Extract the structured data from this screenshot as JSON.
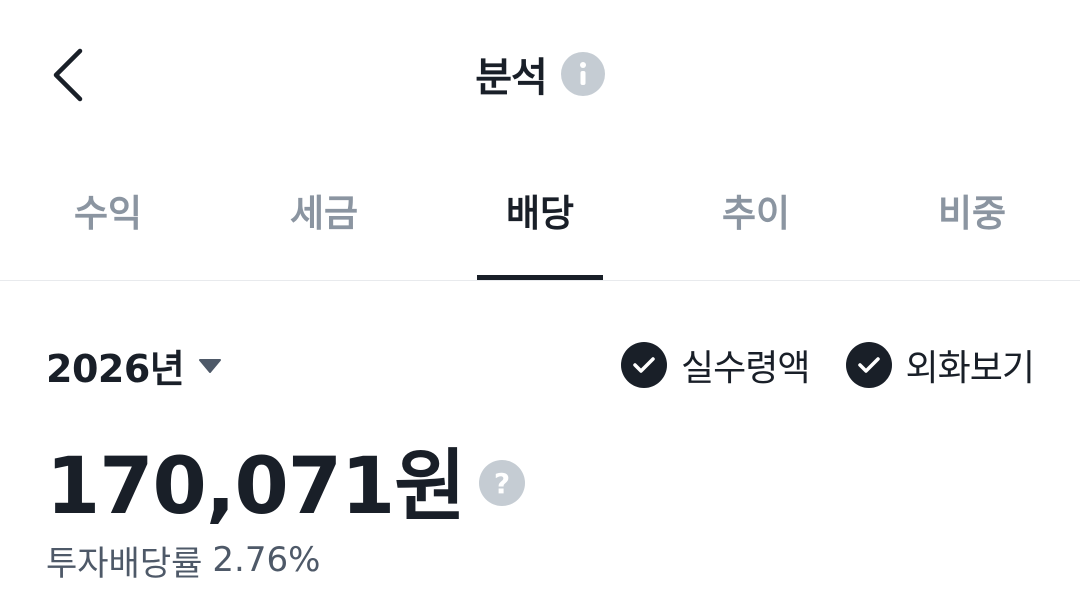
{
  "header": {
    "title": "분석",
    "back_icon": "chevron-left-icon",
    "info_icon": "info-icon"
  },
  "tabs": [
    {
      "label": "수익",
      "active": false
    },
    {
      "label": "세금",
      "active": false
    },
    {
      "label": "배당",
      "active": true
    },
    {
      "label": "추이",
      "active": false
    },
    {
      "label": "비중",
      "active": false
    }
  ],
  "filters": {
    "year": "2026년",
    "net_amount_label": "실수령액",
    "net_amount_checked": true,
    "foreign_currency_label": "외화보기",
    "foreign_currency_checked": true
  },
  "summary": {
    "amount": "170,071원",
    "help_icon": "?",
    "yield_label": "투자배당률",
    "yield_value": "2.76%"
  },
  "colors": {
    "text_primary": "#191f28",
    "text_secondary": "#8b95a1",
    "icon_gray": "#c5ccd3"
  }
}
